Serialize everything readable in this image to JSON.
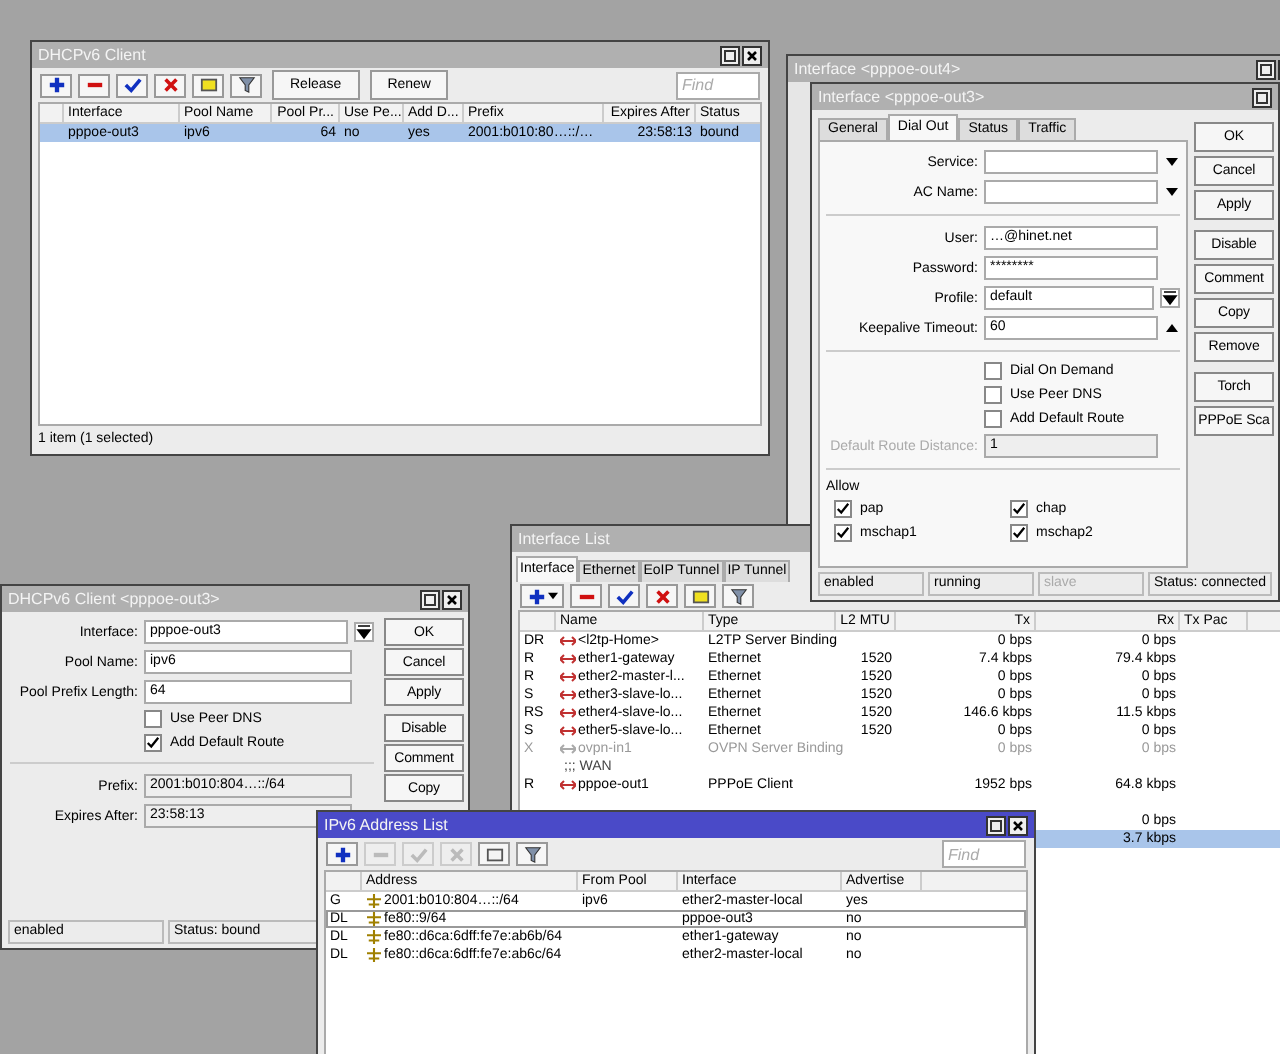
{
  "dhcp_client_list": {
    "title": "DHCPv6 Client",
    "active": false,
    "toolbar": [
      {
        "disabled": false
      },
      {
        "disabled": false
      },
      {
        "disabled": false
      },
      {
        "disabled": false
      },
      {
        "disabled": false
      },
      {
        "disabled": false
      }
    ],
    "text_buttons": [
      "Release",
      "Renew"
    ],
    "find_placeholder": "Find",
    "columns": [
      {
        "label": "Interface",
        "numeric": false
      },
      {
        "label": "Pool Name",
        "numeric": false
      },
      {
        "label": "Pool Pr...",
        "numeric": true
      },
      {
        "label": "Use Pe...",
        "numeric": false
      },
      {
        "label": "Add D...",
        "numeric": false
      },
      {
        "label": "Prefix",
        "numeric": false
      },
      {
        "label": "Expires After",
        "numeric": true
      },
      {
        "label": "Status",
        "numeric": false
      }
    ],
    "rows": [
      {
        "selected": true,
        "cells": [
          "pppoe-out3",
          "ipv6",
          "64",
          "no",
          "yes",
          "2001:b010:80…::/…",
          "23:58:13",
          "bound"
        ]
      }
    ],
    "status": "1 item (1 selected)"
  },
  "pppoe_out4": {
    "title": "Interface <pppoe-out4>",
    "active": false
  },
  "interface_list": {
    "title": "Interface List",
    "active": false,
    "tabs": [
      {
        "label": "Interface",
        "selected": true
      },
      {
        "label": "Ethernet",
        "selected": false
      },
      {
        "label": "EoIP Tunnel",
        "selected": false
      },
      {
        "label": "IP Tunnel",
        "selected": false
      }
    ],
    "add_has_menu": true,
    "toolbar": [
      {
        "disabled": false
      },
      {
        "disabled": false
      },
      {
        "disabled": false
      },
      {
        "disabled": false
      },
      {
        "disabled": false
      },
      {
        "disabled": false
      }
    ],
    "columns": [
      {
        "label": "Name",
        "numeric": false
      },
      {
        "label": "Type",
        "numeric": false
      },
      {
        "label": "L2 MTU",
        "numeric": true
      },
      {
        "label": "Tx",
        "numeric": true
      },
      {
        "label": "Rx",
        "numeric": true
      },
      {
        "label": "Tx Pac",
        "numeric": false
      }
    ],
    "rows": [
      {
        "kind": "iface",
        "flags": "DR",
        "selected": false,
        "disabled": false,
        "cells": [
          "<l2tp-Home>",
          "L2TP Server Binding",
          "",
          "0 bps",
          "0 bps",
          ""
        ]
      },
      {
        "kind": "iface",
        "flags": "R",
        "selected": false,
        "disabled": false,
        "cells": [
          "ether1-gateway",
          "Ethernet",
          "1520",
          "7.4 kbps",
          "79.4 kbps",
          ""
        ]
      },
      {
        "kind": "iface",
        "flags": "R",
        "selected": false,
        "disabled": false,
        "cells": [
          "ether2-master-l...",
          "Ethernet",
          "1520",
          "0 bps",
          "0 bps",
          ""
        ]
      },
      {
        "kind": "iface",
        "flags": "S",
        "selected": false,
        "disabled": false,
        "cells": [
          "ether3-slave-lo...",
          "Ethernet",
          "1520",
          "0 bps",
          "0 bps",
          ""
        ]
      },
      {
        "kind": "iface",
        "flags": "RS",
        "selected": false,
        "disabled": false,
        "cells": [
          "ether4-slave-lo...",
          "Ethernet",
          "1520",
          "146.6 kbps",
          "11.5 kbps",
          ""
        ]
      },
      {
        "kind": "iface",
        "flags": "S",
        "selected": false,
        "disabled": false,
        "cells": [
          "ether5-slave-lo...",
          "Ethernet",
          "1520",
          "0 bps",
          "0 bps",
          ""
        ]
      },
      {
        "kind": "iface",
        "flags": "X",
        "selected": false,
        "disabled": true,
        "cells": [
          "ovpn-in1",
          "OVPN Server Binding",
          "",
          "0 bps",
          "0 bps",
          ""
        ]
      },
      {
        "kind": "comment",
        "text": ";;; WAN",
        "selected": false
      },
      {
        "kind": "iface",
        "flags": "R",
        "selected": false,
        "disabled": false,
        "cells": [
          "pppoe-out1",
          "PPPoE Client",
          "",
          "1952 bps",
          "64.8 kbps",
          ""
        ]
      },
      {
        "kind": "comment",
        "selected": false
      },
      {
        "kind": "iface",
        "flags": "",
        "selected": false,
        "disabled": false,
        "cells": [
          "",
          "",
          "",
          "",
          "0 bps",
          ""
        ]
      },
      {
        "kind": "iface",
        "flags": "",
        "selected": true,
        "disabled": false,
        "cells": [
          "",
          "",
          "",
          "",
          "3.7 kbps",
          ""
        ]
      }
    ]
  },
  "pppoe_out3": {
    "title": "Interface <pppoe-out3>",
    "active": false,
    "tabs": [
      {
        "label": "General",
        "selected": false
      },
      {
        "label": "Dial Out",
        "selected": true
      },
      {
        "label": "Status",
        "selected": false
      },
      {
        "label": "Traffic",
        "selected": false
      }
    ],
    "fields": [
      {
        "kind": "select",
        "label": "Service:",
        "disabled": false
      },
      {
        "kind": "select",
        "label": "AC Name:",
        "disabled": false
      },
      {
        "kind": "separator"
      },
      {
        "kind": "text",
        "label": "User:",
        "value": "…@hinet.net",
        "disabled": false
      },
      {
        "kind": "text",
        "label": "Password:",
        "value": "********",
        "disabled": false
      },
      {
        "kind": "combo",
        "label": "Profile:",
        "value": "default",
        "disabled": false
      },
      {
        "kind": "spin",
        "label": "Keepalive Timeout:",
        "value": "60",
        "disabled": false
      },
      {
        "kind": "separator"
      },
      {
        "kind": "check",
        "label": "Dial On Demand",
        "checked": false
      },
      {
        "kind": "check",
        "label": "Use Peer DNS",
        "checked": false
      },
      {
        "kind": "check",
        "label": "Add Default Route",
        "checked": false
      },
      {
        "kind": "text",
        "label": "Default Route Distance:",
        "value": "1",
        "disabled": true
      }
    ],
    "allow": {
      "title": "Allow",
      "items": [
        {
          "label": "pap",
          "checked": true
        },
        {
          "label": "chap",
          "checked": true
        },
        {
          "label": "mschap1",
          "checked": true
        },
        {
          "label": "mschap2",
          "checked": true
        }
      ]
    },
    "buttons": [
      "OK",
      "Cancel",
      "Apply",
      "Disable",
      "Comment",
      "Copy",
      "Remove",
      "Torch",
      "PPPoE Sca"
    ],
    "status": [
      {
        "text": "enabled",
        "disabled": false
      },
      {
        "text": "running",
        "disabled": false
      },
      {
        "text": "slave",
        "disabled": true
      },
      {
        "text": "Status: connected",
        "disabled": false
      }
    ]
  },
  "dhcp_client_form": {
    "title": "DHCPv6 Client <pppoe-out3>",
    "active": false,
    "fields": [
      {
        "kind": "combo",
        "label": "Interface:",
        "value": "pppoe-out3",
        "disabled": false
      },
      {
        "kind": "text",
        "label": "Pool Name:",
        "value": "ipv6",
        "disabled": false
      },
      {
        "kind": "text",
        "label": "Pool Prefix Length:",
        "value": "64",
        "disabled": false
      },
      {
        "kind": "check",
        "label": "Use Peer DNS",
        "checked": false
      },
      {
        "kind": "check",
        "label": "Add Default Route",
        "checked": true
      },
      {
        "kind": "separator"
      },
      {
        "kind": "text",
        "label": "Prefix:",
        "value": "2001:b010:804…::/64",
        "disabled": true
      },
      {
        "kind": "text",
        "label": "Expires After:",
        "value": "23:58:13",
        "disabled": true
      }
    ],
    "buttons": [
      "OK",
      "Cancel",
      "Apply",
      "Disable",
      "Comment",
      "Copy"
    ],
    "status": [
      {
        "text": "enabled",
        "disabled": false
      },
      {
        "text": "Status: bound",
        "disabled": false
      }
    ]
  },
  "ipv6_address_list": {
    "title": "IPv6 Address List",
    "active": true,
    "toolbar": [
      {
        "disabled": false
      },
      {
        "disabled": true
      },
      {
        "disabled": true
      },
      {
        "disabled": true
      },
      {
        "disabled": false
      },
      {
        "disabled": false
      }
    ],
    "find_placeholder": "Find",
    "columns": [
      {
        "label": "Address",
        "numeric": false
      },
      {
        "label": "From Pool",
        "numeric": false
      },
      {
        "label": "Interface",
        "numeric": false
      },
      {
        "label": "Advertise",
        "numeric": false
      }
    ],
    "rows": [
      {
        "flags": "G",
        "selected": false,
        "cells": [
          "2001:b010:804…::/64",
          "ipv6",
          "ether2-master-local",
          "yes"
        ]
      },
      {
        "flags": "DL",
        "selected": true,
        "cells": [
          "fe80::9/64",
          "",
          "pppoe-out3",
          "no"
        ]
      },
      {
        "flags": "DL",
        "selected": false,
        "cells": [
          "fe80::d6ca:6dff:fe7e:ab6b/64",
          "",
          "ether1-gateway",
          "no"
        ]
      },
      {
        "flags": "DL",
        "selected": false,
        "cells": [
          "fe80::d6ca:6dff:fe7e:ab6c/64",
          "",
          "ether2-master-local",
          "no"
        ]
      }
    ]
  }
}
